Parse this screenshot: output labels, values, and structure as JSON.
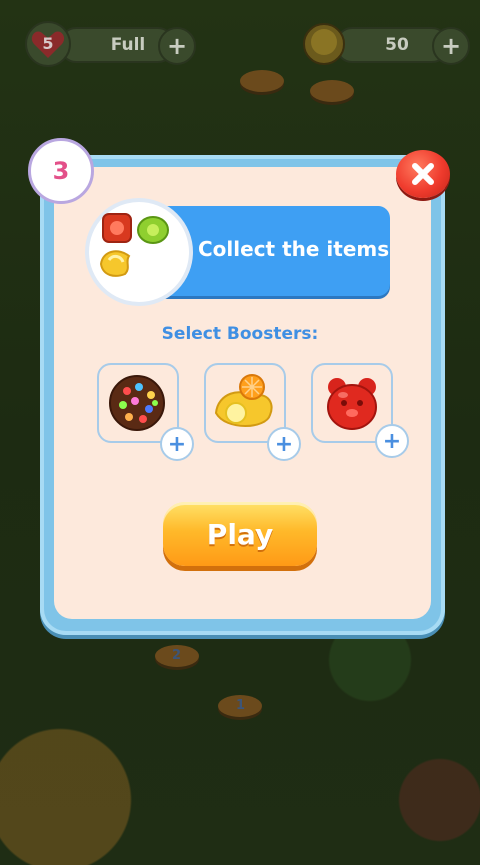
{
  "hud": {
    "lives_count": "5",
    "lives_status": "Full",
    "coins": "50",
    "plus": "+"
  },
  "map": {
    "node_labels": [
      "2",
      "1"
    ]
  },
  "dialog": {
    "level_number": "3",
    "goal_text": "Collect the items",
    "boosters_label": "Select Boosters:",
    "play_label": "Play",
    "booster_plus": "+",
    "boosters": [
      {
        "icon": "chocolate-candy-icon"
      },
      {
        "icon": "lemon-candy-icon"
      },
      {
        "icon": "gummy-bear-icon"
      }
    ]
  },
  "colors": {
    "accent_blue": "#3e9ff3",
    "play_orange": "#ff9a16",
    "close_red": "#ef3b2d",
    "level_pink": "#e35089"
  }
}
